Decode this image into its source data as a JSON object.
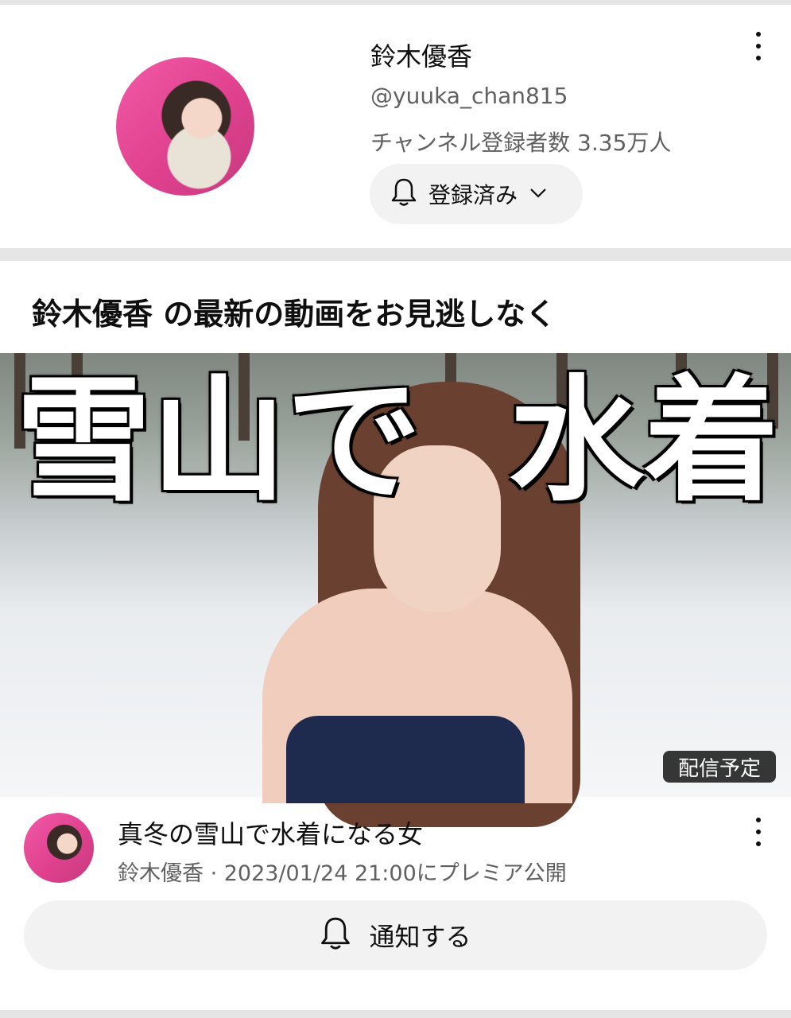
{
  "channel": {
    "name": "鈴木優香",
    "handle": "@yuuka_chan815",
    "subscribers": "チャンネル登録者数 3.35万人",
    "subscribe_button_label": "登録済み"
  },
  "promo": {
    "heading": "鈴木優香 の最新の動画をお見逃しなく"
  },
  "video": {
    "thumbnail_text_left": "雪山で",
    "thumbnail_text_right": "水着",
    "badge": "配信予定",
    "title": "真冬の雪山で水着になる女",
    "meta": "鈴木優香 · 2023/01/24 21:00にプレミア公開",
    "notify_button_label": "通知する"
  },
  "colors": {
    "button_bg": "#f2f2f2",
    "secondary_text": "#606060",
    "avatar_bg": "#e0418f"
  },
  "icons": {
    "more": "more-vert-icon",
    "bell": "bell-icon",
    "chevron": "chevron-down-icon"
  }
}
